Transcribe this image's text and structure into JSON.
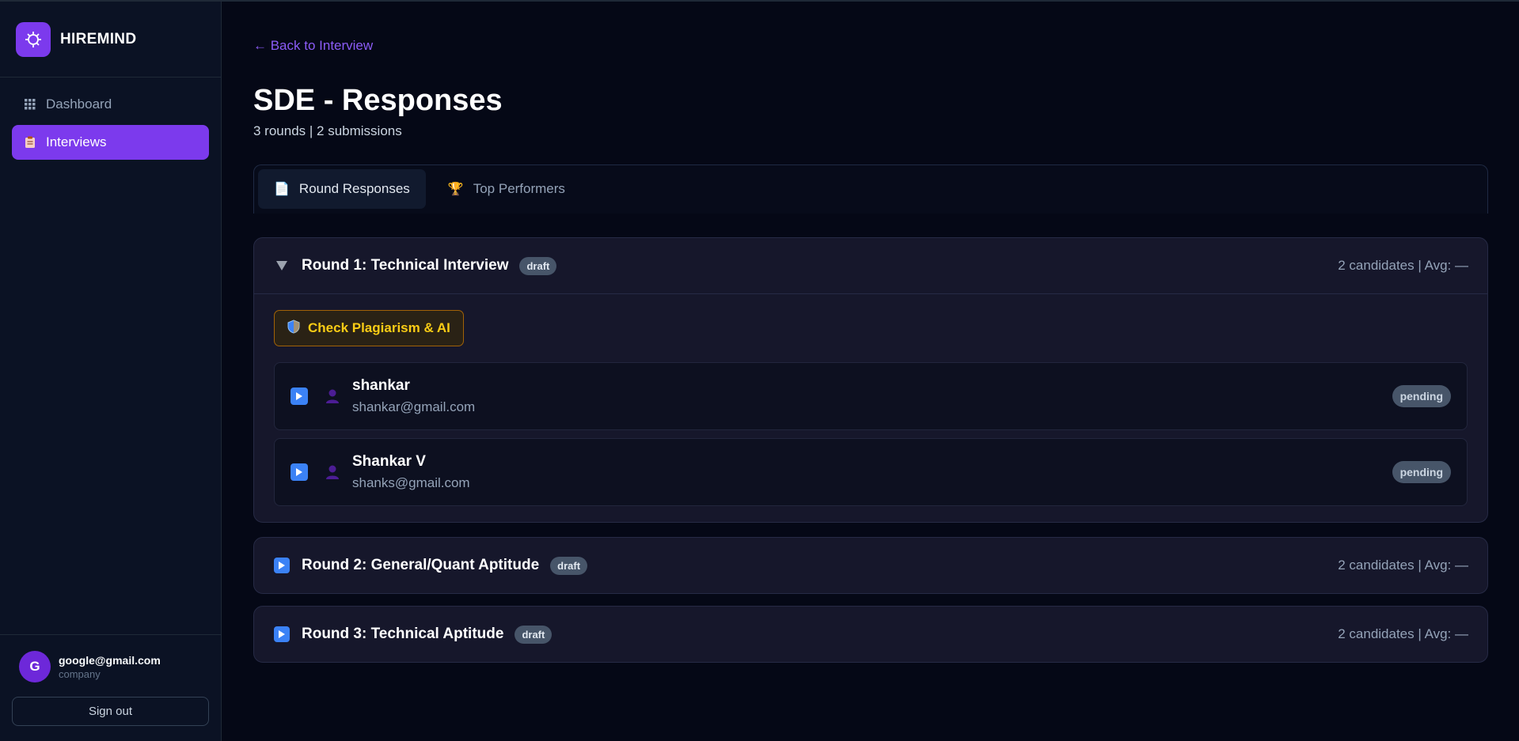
{
  "app": {
    "name": "HIREMIND"
  },
  "sidebar": {
    "items": [
      {
        "label": "Dashboard",
        "icon": "grid-icon",
        "active": false
      },
      {
        "label": "Interviews",
        "icon": "clipboard-icon",
        "active": true
      }
    ],
    "user": {
      "initial": "G",
      "email": "google@gmail.com",
      "role": "company"
    },
    "signout_label": "Sign out"
  },
  "main": {
    "back_link": "← Back to Interview",
    "title": "SDE - Responses",
    "subtitle": "3 rounds | 2 submissions",
    "tabs": [
      {
        "label": "Round Responses",
        "icon": "📄",
        "active": true
      },
      {
        "label": "Top Performers",
        "icon": "🏆",
        "active": false
      }
    ],
    "rounds": [
      {
        "title": "Round 1: Technical Interview",
        "badge": "draft",
        "meta": "2 candidates | Avg: —",
        "expanded": true,
        "plagiarism_label": "Check Plagiarism & AI",
        "candidates": [
          {
            "name": "shankar",
            "email": "shankar@gmail.com",
            "status": "pending"
          },
          {
            "name": "Shankar V",
            "email": "shanks@gmail.com",
            "status": "pending"
          }
        ]
      },
      {
        "title": "Round 2: General/Quant Aptitude",
        "badge": "draft",
        "meta": "2 candidates | Avg: —",
        "expanded": false
      },
      {
        "title": "Round 3: Technical Aptitude",
        "badge": "draft",
        "meta": "2 candidates | Avg: —",
        "expanded": false
      }
    ]
  }
}
